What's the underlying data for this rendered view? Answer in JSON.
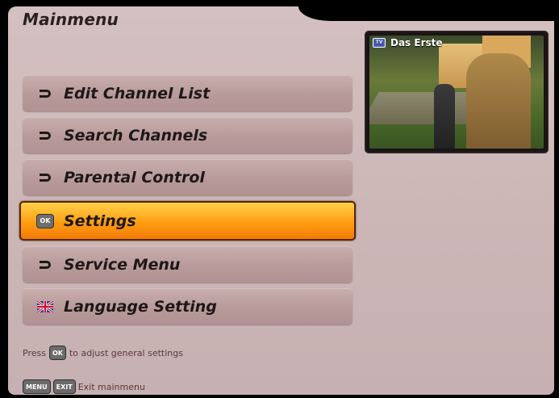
{
  "title": "Mainmenu",
  "preview": {
    "channel": "Das Erste",
    "badge": "TV"
  },
  "menu": {
    "items": [
      {
        "label": "Edit Channel List",
        "icon": "arrow-icon"
      },
      {
        "label": "Search Channels",
        "icon": "arrow-icon"
      },
      {
        "label": "Parental Control",
        "icon": "arrow-icon"
      },
      {
        "label": "Settings",
        "icon": "ok-button-icon",
        "selected": true
      },
      {
        "label": "Service Menu",
        "icon": "arrow-icon"
      },
      {
        "label": "Language Setting",
        "icon": "uk-flag-icon"
      }
    ]
  },
  "help": {
    "press": "Press",
    "ok_key": "OK",
    "adjust": "to adjust general settings",
    "menu_key": "MENU",
    "exit_key": "EXIT",
    "exit_text": "Exit mainmenu"
  },
  "colors": {
    "selected_top": "#ffd24a",
    "selected_bottom": "#f37b08",
    "panel": "#cbb5b5"
  }
}
